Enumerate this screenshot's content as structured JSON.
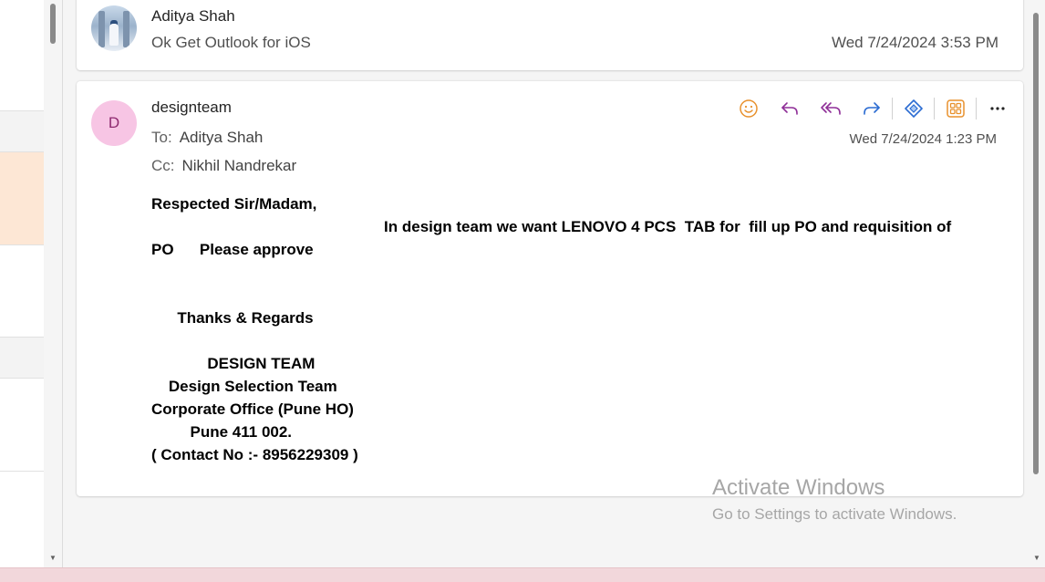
{
  "thread": [
    {
      "sender": "Aditya Shah",
      "preview": "Ok Get Outlook for iOS",
      "date": "Wed 7/24/2024 3:53 PM"
    },
    {
      "avatar_initial": "D",
      "sender": "designteam",
      "to_label": "To:",
      "to": "Aditya Shah",
      "cc_label": "Cc:",
      "cc": "Nikhil Nandrekar",
      "date": "Wed 7/24/2024 1:23 PM",
      "body_lines": [
        "Respected Sir/Madam,",
        "                                                      In design team we want LENOVO 4 PCS  TAB for  fill up PO and requisition of",
        "PO      Please approve",
        "",
        "",
        "      Thanks & Regards",
        "",
        "             DESIGN TEAM",
        "    Design Selection Team",
        "Corporate Office (Pune HO)",
        "         Pune 411 002.",
        "( Contact No :- 8956229309 )"
      ]
    }
  ],
  "toolbar_icons": [
    "emoji-icon",
    "reply-icon",
    "reply-all-icon",
    "forward-icon",
    "copilot-icon",
    "apps-icon",
    "more-icon"
  ],
  "watermark": {
    "line1": "Activate Windows",
    "line2": "Go to Settings to activate Windows."
  },
  "colors": {
    "avatar_bg": "#f7c5e4",
    "avatar_fg": "#8e2a6f",
    "selected_row": "#fde7d5",
    "emoji": "#e8912d",
    "reply": "#8f2f98",
    "forward": "#2b6cd2",
    "apps": "#e8912d"
  }
}
